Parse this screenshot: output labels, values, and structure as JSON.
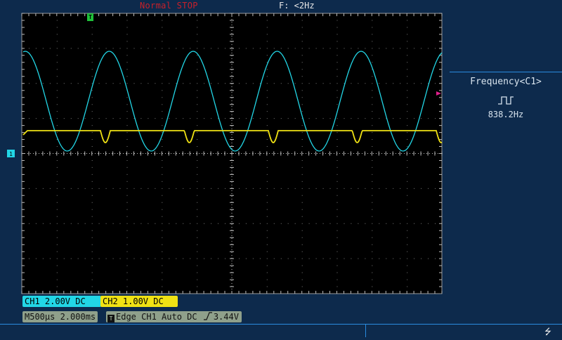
{
  "status": {
    "mode": "Normal STOP",
    "trigger_freq": "F: <2Hz"
  },
  "trigger_marker": {
    "label": "T",
    "icon": "trigger-position-icon"
  },
  "channel_marker": {
    "label": "1",
    "icon": "channel-1-ground-icon"
  },
  "measurement": {
    "title": "Frequency<C1>",
    "icon": "square-wave-icon",
    "value": "838.2Hz"
  },
  "channels": {
    "ch1": {
      "label": "CH1 2.00V DC",
      "color": "#22d6e6"
    },
    "ch2": {
      "label": "CH2 1.00V DC",
      "color": "#f0e214"
    }
  },
  "timebase": {
    "label": "M500µs 2.000ms"
  },
  "trigger": {
    "glyph": "T",
    "label": "Edge CH1 Auto DC",
    "edge_icon": "rising-edge-icon",
    "level": "3.44V"
  },
  "usb": {
    "icon": "usb-icon"
  },
  "colors": {
    "background": "#0d2a4c",
    "grid_bg": "#000000",
    "grid_dots": "#7a7a7a",
    "ch1": "#22d6e6",
    "ch2": "#f0e214",
    "trigger_level_marker": "#e0208c"
  }
}
